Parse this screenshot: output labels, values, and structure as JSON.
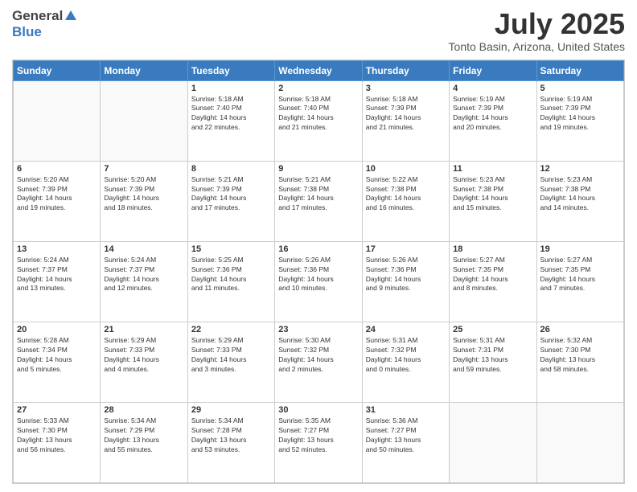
{
  "logo": {
    "general": "General",
    "blue": "Blue"
  },
  "title": "July 2025",
  "location": "Tonto Basin, Arizona, United States",
  "days_of_week": [
    "Sunday",
    "Monday",
    "Tuesday",
    "Wednesday",
    "Thursday",
    "Friday",
    "Saturday"
  ],
  "weeks": [
    [
      {
        "day": "",
        "info": ""
      },
      {
        "day": "",
        "info": ""
      },
      {
        "day": "1",
        "info": "Sunrise: 5:18 AM\nSunset: 7:40 PM\nDaylight: 14 hours\nand 22 minutes."
      },
      {
        "day": "2",
        "info": "Sunrise: 5:18 AM\nSunset: 7:40 PM\nDaylight: 14 hours\nand 21 minutes."
      },
      {
        "day": "3",
        "info": "Sunrise: 5:18 AM\nSunset: 7:39 PM\nDaylight: 14 hours\nand 21 minutes."
      },
      {
        "day": "4",
        "info": "Sunrise: 5:19 AM\nSunset: 7:39 PM\nDaylight: 14 hours\nand 20 minutes."
      },
      {
        "day": "5",
        "info": "Sunrise: 5:19 AM\nSunset: 7:39 PM\nDaylight: 14 hours\nand 19 minutes."
      }
    ],
    [
      {
        "day": "6",
        "info": "Sunrise: 5:20 AM\nSunset: 7:39 PM\nDaylight: 14 hours\nand 19 minutes."
      },
      {
        "day": "7",
        "info": "Sunrise: 5:20 AM\nSunset: 7:39 PM\nDaylight: 14 hours\nand 18 minutes."
      },
      {
        "day": "8",
        "info": "Sunrise: 5:21 AM\nSunset: 7:39 PM\nDaylight: 14 hours\nand 17 minutes."
      },
      {
        "day": "9",
        "info": "Sunrise: 5:21 AM\nSunset: 7:38 PM\nDaylight: 14 hours\nand 17 minutes."
      },
      {
        "day": "10",
        "info": "Sunrise: 5:22 AM\nSunset: 7:38 PM\nDaylight: 14 hours\nand 16 minutes."
      },
      {
        "day": "11",
        "info": "Sunrise: 5:23 AM\nSunset: 7:38 PM\nDaylight: 14 hours\nand 15 minutes."
      },
      {
        "day": "12",
        "info": "Sunrise: 5:23 AM\nSunset: 7:38 PM\nDaylight: 14 hours\nand 14 minutes."
      }
    ],
    [
      {
        "day": "13",
        "info": "Sunrise: 5:24 AM\nSunset: 7:37 PM\nDaylight: 14 hours\nand 13 minutes."
      },
      {
        "day": "14",
        "info": "Sunrise: 5:24 AM\nSunset: 7:37 PM\nDaylight: 14 hours\nand 12 minutes."
      },
      {
        "day": "15",
        "info": "Sunrise: 5:25 AM\nSunset: 7:36 PM\nDaylight: 14 hours\nand 11 minutes."
      },
      {
        "day": "16",
        "info": "Sunrise: 5:26 AM\nSunset: 7:36 PM\nDaylight: 14 hours\nand 10 minutes."
      },
      {
        "day": "17",
        "info": "Sunrise: 5:26 AM\nSunset: 7:36 PM\nDaylight: 14 hours\nand 9 minutes."
      },
      {
        "day": "18",
        "info": "Sunrise: 5:27 AM\nSunset: 7:35 PM\nDaylight: 14 hours\nand 8 minutes."
      },
      {
        "day": "19",
        "info": "Sunrise: 5:27 AM\nSunset: 7:35 PM\nDaylight: 14 hours\nand 7 minutes."
      }
    ],
    [
      {
        "day": "20",
        "info": "Sunrise: 5:28 AM\nSunset: 7:34 PM\nDaylight: 14 hours\nand 5 minutes."
      },
      {
        "day": "21",
        "info": "Sunrise: 5:29 AM\nSunset: 7:33 PM\nDaylight: 14 hours\nand 4 minutes."
      },
      {
        "day": "22",
        "info": "Sunrise: 5:29 AM\nSunset: 7:33 PM\nDaylight: 14 hours\nand 3 minutes."
      },
      {
        "day": "23",
        "info": "Sunrise: 5:30 AM\nSunset: 7:32 PM\nDaylight: 14 hours\nand 2 minutes."
      },
      {
        "day": "24",
        "info": "Sunrise: 5:31 AM\nSunset: 7:32 PM\nDaylight: 14 hours\nand 0 minutes."
      },
      {
        "day": "25",
        "info": "Sunrise: 5:31 AM\nSunset: 7:31 PM\nDaylight: 13 hours\nand 59 minutes."
      },
      {
        "day": "26",
        "info": "Sunrise: 5:32 AM\nSunset: 7:30 PM\nDaylight: 13 hours\nand 58 minutes."
      }
    ],
    [
      {
        "day": "27",
        "info": "Sunrise: 5:33 AM\nSunset: 7:30 PM\nDaylight: 13 hours\nand 56 minutes."
      },
      {
        "day": "28",
        "info": "Sunrise: 5:34 AM\nSunset: 7:29 PM\nDaylight: 13 hours\nand 55 minutes."
      },
      {
        "day": "29",
        "info": "Sunrise: 5:34 AM\nSunset: 7:28 PM\nDaylight: 13 hours\nand 53 minutes."
      },
      {
        "day": "30",
        "info": "Sunrise: 5:35 AM\nSunset: 7:27 PM\nDaylight: 13 hours\nand 52 minutes."
      },
      {
        "day": "31",
        "info": "Sunrise: 5:36 AM\nSunset: 7:27 PM\nDaylight: 13 hours\nand 50 minutes."
      },
      {
        "day": "",
        "info": ""
      },
      {
        "day": "",
        "info": ""
      }
    ]
  ]
}
